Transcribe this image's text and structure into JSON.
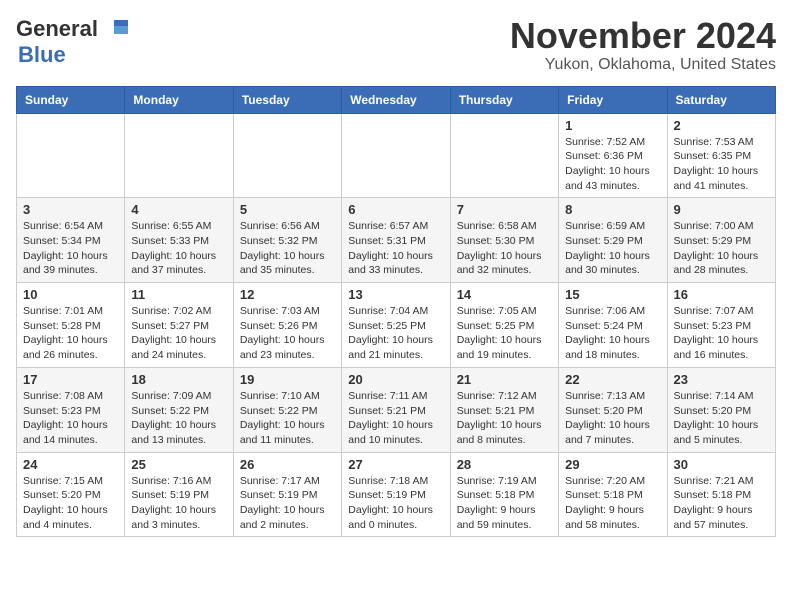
{
  "header": {
    "logo_general": "General",
    "logo_blue": "Blue",
    "month": "November 2024",
    "location": "Yukon, Oklahoma, United States"
  },
  "weekdays": [
    "Sunday",
    "Monday",
    "Tuesday",
    "Wednesday",
    "Thursday",
    "Friday",
    "Saturday"
  ],
  "weeks": [
    [
      {
        "day": "",
        "detail": ""
      },
      {
        "day": "",
        "detail": ""
      },
      {
        "day": "",
        "detail": ""
      },
      {
        "day": "",
        "detail": ""
      },
      {
        "day": "",
        "detail": ""
      },
      {
        "day": "1",
        "detail": "Sunrise: 7:52 AM\nSunset: 6:36 PM\nDaylight: 10 hours and 43 minutes."
      },
      {
        "day": "2",
        "detail": "Sunrise: 7:53 AM\nSunset: 6:35 PM\nDaylight: 10 hours and 41 minutes."
      }
    ],
    [
      {
        "day": "3",
        "detail": "Sunrise: 6:54 AM\nSunset: 5:34 PM\nDaylight: 10 hours and 39 minutes."
      },
      {
        "day": "4",
        "detail": "Sunrise: 6:55 AM\nSunset: 5:33 PM\nDaylight: 10 hours and 37 minutes."
      },
      {
        "day": "5",
        "detail": "Sunrise: 6:56 AM\nSunset: 5:32 PM\nDaylight: 10 hours and 35 minutes."
      },
      {
        "day": "6",
        "detail": "Sunrise: 6:57 AM\nSunset: 5:31 PM\nDaylight: 10 hours and 33 minutes."
      },
      {
        "day": "7",
        "detail": "Sunrise: 6:58 AM\nSunset: 5:30 PM\nDaylight: 10 hours and 32 minutes."
      },
      {
        "day": "8",
        "detail": "Sunrise: 6:59 AM\nSunset: 5:29 PM\nDaylight: 10 hours and 30 minutes."
      },
      {
        "day": "9",
        "detail": "Sunrise: 7:00 AM\nSunset: 5:29 PM\nDaylight: 10 hours and 28 minutes."
      }
    ],
    [
      {
        "day": "10",
        "detail": "Sunrise: 7:01 AM\nSunset: 5:28 PM\nDaylight: 10 hours and 26 minutes."
      },
      {
        "day": "11",
        "detail": "Sunrise: 7:02 AM\nSunset: 5:27 PM\nDaylight: 10 hours and 24 minutes."
      },
      {
        "day": "12",
        "detail": "Sunrise: 7:03 AM\nSunset: 5:26 PM\nDaylight: 10 hours and 23 minutes."
      },
      {
        "day": "13",
        "detail": "Sunrise: 7:04 AM\nSunset: 5:25 PM\nDaylight: 10 hours and 21 minutes."
      },
      {
        "day": "14",
        "detail": "Sunrise: 7:05 AM\nSunset: 5:25 PM\nDaylight: 10 hours and 19 minutes."
      },
      {
        "day": "15",
        "detail": "Sunrise: 7:06 AM\nSunset: 5:24 PM\nDaylight: 10 hours and 18 minutes."
      },
      {
        "day": "16",
        "detail": "Sunrise: 7:07 AM\nSunset: 5:23 PM\nDaylight: 10 hours and 16 minutes."
      }
    ],
    [
      {
        "day": "17",
        "detail": "Sunrise: 7:08 AM\nSunset: 5:23 PM\nDaylight: 10 hours and 14 minutes."
      },
      {
        "day": "18",
        "detail": "Sunrise: 7:09 AM\nSunset: 5:22 PM\nDaylight: 10 hours and 13 minutes."
      },
      {
        "day": "19",
        "detail": "Sunrise: 7:10 AM\nSunset: 5:22 PM\nDaylight: 10 hours and 11 minutes."
      },
      {
        "day": "20",
        "detail": "Sunrise: 7:11 AM\nSunset: 5:21 PM\nDaylight: 10 hours and 10 minutes."
      },
      {
        "day": "21",
        "detail": "Sunrise: 7:12 AM\nSunset: 5:21 PM\nDaylight: 10 hours and 8 minutes."
      },
      {
        "day": "22",
        "detail": "Sunrise: 7:13 AM\nSunset: 5:20 PM\nDaylight: 10 hours and 7 minutes."
      },
      {
        "day": "23",
        "detail": "Sunrise: 7:14 AM\nSunset: 5:20 PM\nDaylight: 10 hours and 5 minutes."
      }
    ],
    [
      {
        "day": "24",
        "detail": "Sunrise: 7:15 AM\nSunset: 5:20 PM\nDaylight: 10 hours and 4 minutes."
      },
      {
        "day": "25",
        "detail": "Sunrise: 7:16 AM\nSunset: 5:19 PM\nDaylight: 10 hours and 3 minutes."
      },
      {
        "day": "26",
        "detail": "Sunrise: 7:17 AM\nSunset: 5:19 PM\nDaylight: 10 hours and 2 minutes."
      },
      {
        "day": "27",
        "detail": "Sunrise: 7:18 AM\nSunset: 5:19 PM\nDaylight: 10 hours and 0 minutes."
      },
      {
        "day": "28",
        "detail": "Sunrise: 7:19 AM\nSunset: 5:18 PM\nDaylight: 9 hours and 59 minutes."
      },
      {
        "day": "29",
        "detail": "Sunrise: 7:20 AM\nSunset: 5:18 PM\nDaylight: 9 hours and 58 minutes."
      },
      {
        "day": "30",
        "detail": "Sunrise: 7:21 AM\nSunset: 5:18 PM\nDaylight: 9 hours and 57 minutes."
      }
    ]
  ],
  "colors": {
    "header_bg": "#3a6db5",
    "header_text": "#ffffff",
    "accent": "#3a6db5"
  }
}
